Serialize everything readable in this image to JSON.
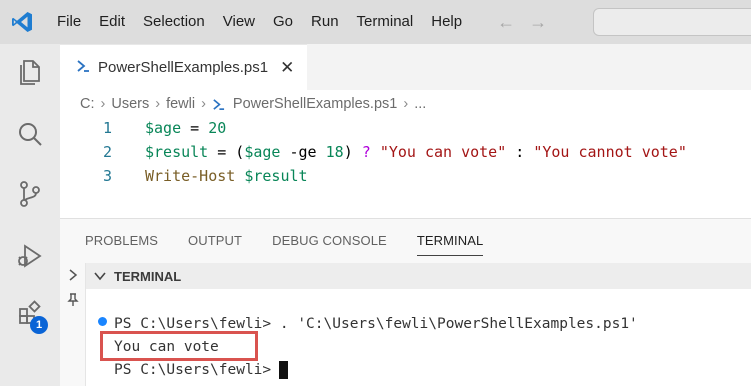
{
  "menu": {
    "items": [
      "File",
      "Edit",
      "Selection",
      "View",
      "Go",
      "Run",
      "Terminal",
      "Help"
    ]
  },
  "editor": {
    "tab_label": "PowerShellExamples.ps1",
    "tab_close": "✕",
    "breadcrumb": {
      "drive": "C:",
      "folder1": "Users",
      "folder2": "fewli",
      "file": "PowerShellExamples.ps1",
      "more": "..."
    },
    "line_numbers": [
      "1",
      "2",
      "3"
    ],
    "lines": {
      "l1_var": "$age",
      "l1_eq": " = ",
      "l1_val": "20",
      "l2_var": "$result",
      "l2_eq": " = (",
      "l2_var2": "$age",
      "l2_op": " -ge ",
      "l2_num": "18",
      "l2_close": ") ",
      "l2_q": "? ",
      "l2_str1": "\"You can vote\"",
      "l2_colon": " : ",
      "l2_str2": "\"You cannot vote\"",
      "l3_cmd": "Write-Host",
      "l3_sp": " ",
      "l3_var": "$result"
    }
  },
  "panel": {
    "tabs": [
      "PROBLEMS",
      "OUTPUT",
      "DEBUG CONSOLE",
      "TERMINAL"
    ],
    "active_tab": "TERMINAL",
    "section_label": "TERMINAL",
    "terminal": {
      "line1": "PS C:\\Users\\fewli> . 'C:\\Users\\fewli\\PowerShellExamples.ps1'",
      "line2": "You can vote",
      "line3": "PS C:\\Users\\fewli>"
    }
  },
  "activity": {
    "extensions_badge": "1"
  },
  "icons": {
    "logo": "vscode-logo-icon",
    "explorer": "files-icon",
    "search": "search-icon",
    "scm": "source-control-icon",
    "debug": "run-debug-icon",
    "extensions": "extensions-icon"
  },
  "colors": {
    "accent": "#0a64d6",
    "highlight_border": "#d9534f"
  }
}
